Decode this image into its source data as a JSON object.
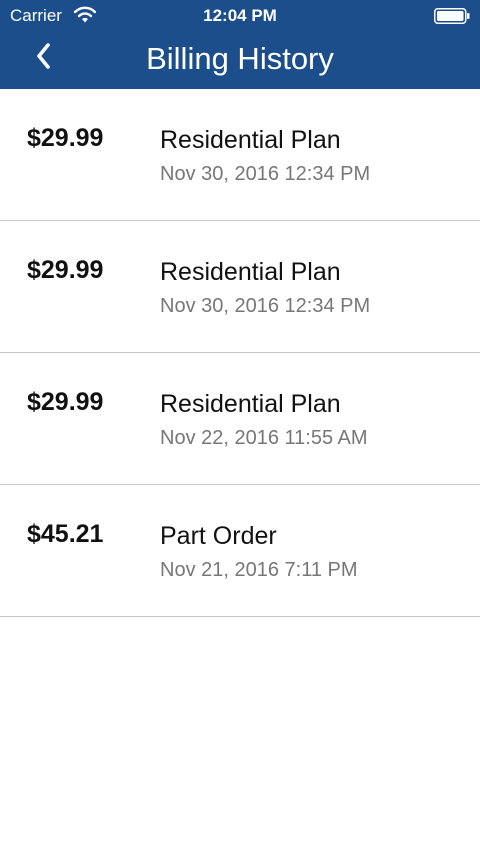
{
  "status_bar": {
    "carrier": "Carrier",
    "time": "12:04 PM"
  },
  "nav": {
    "title": "Billing History",
    "back_icon": "chevron-left-icon"
  },
  "colors": {
    "header_bg": "#1b4e8a",
    "header_text": "#ffffff",
    "divider": "#c8c8cc",
    "secondary_text": "#777777"
  },
  "billing": [
    {
      "amount": "$29.99",
      "description": "Residential Plan",
      "date": "Nov 30, 2016 12:34 PM"
    },
    {
      "amount": "$29.99",
      "description": "Residential Plan",
      "date": "Nov 30, 2016 12:34 PM"
    },
    {
      "amount": "$29.99",
      "description": "Residential Plan",
      "date": "Nov 22, 2016 11:55 AM"
    },
    {
      "amount": "$45.21",
      "description": "Part Order",
      "date": "Nov 21, 2016 7:11 PM"
    }
  ]
}
